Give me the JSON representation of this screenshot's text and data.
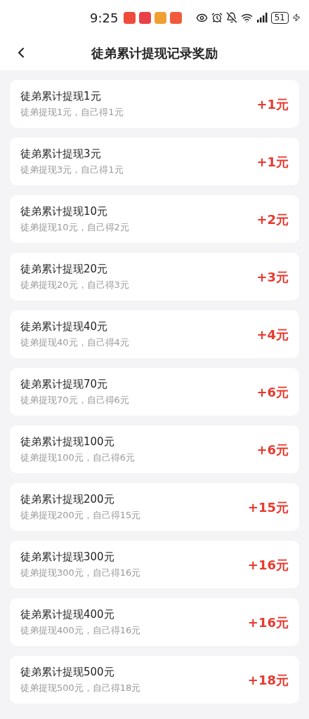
{
  "status_bar": {
    "time": "9:25",
    "battery": "51"
  },
  "header": {
    "title": "徒弟累计提现记录奖励"
  },
  "rewards": [
    {
      "title": "徒弟累计提现1元",
      "detail": "徒弟提现1元，自己得1元",
      "amount": "+1元"
    },
    {
      "title": "徒弟累计提现3元",
      "detail": "徒弟提现3元，自己得1元",
      "amount": "+1元"
    },
    {
      "title": "徒弟累计提现10元",
      "detail": "徒弟提现10元，自己得2元",
      "amount": "+2元"
    },
    {
      "title": "徒弟累计提现20元",
      "detail": "徒弟提现20元，自己得3元",
      "amount": "+3元"
    },
    {
      "title": "徒弟累计提现40元",
      "detail": "徒弟提现40元，自己得4元",
      "amount": "+4元"
    },
    {
      "title": "徒弟累计提现70元",
      "detail": "徒弟提现70元，自己得6元",
      "amount": "+6元"
    },
    {
      "title": "徒弟累计提现100元",
      "detail": "徒弟提现100元，自己得6元",
      "amount": "+6元"
    },
    {
      "title": "徒弟累计提现200元",
      "detail": "徒弟提现200元，自己得15元",
      "amount": "+15元"
    },
    {
      "title": "徒弟累计提现300元",
      "detail": "徒弟提现300元，自己得16元",
      "amount": "+16元"
    },
    {
      "title": "徒弟累计提现400元",
      "detail": "徒弟提现400元，自己得16元",
      "amount": "+16元"
    },
    {
      "title": "徒弟累计提现500元",
      "detail": "徒弟提现500元，自己得18元",
      "amount": "+18元"
    }
  ]
}
